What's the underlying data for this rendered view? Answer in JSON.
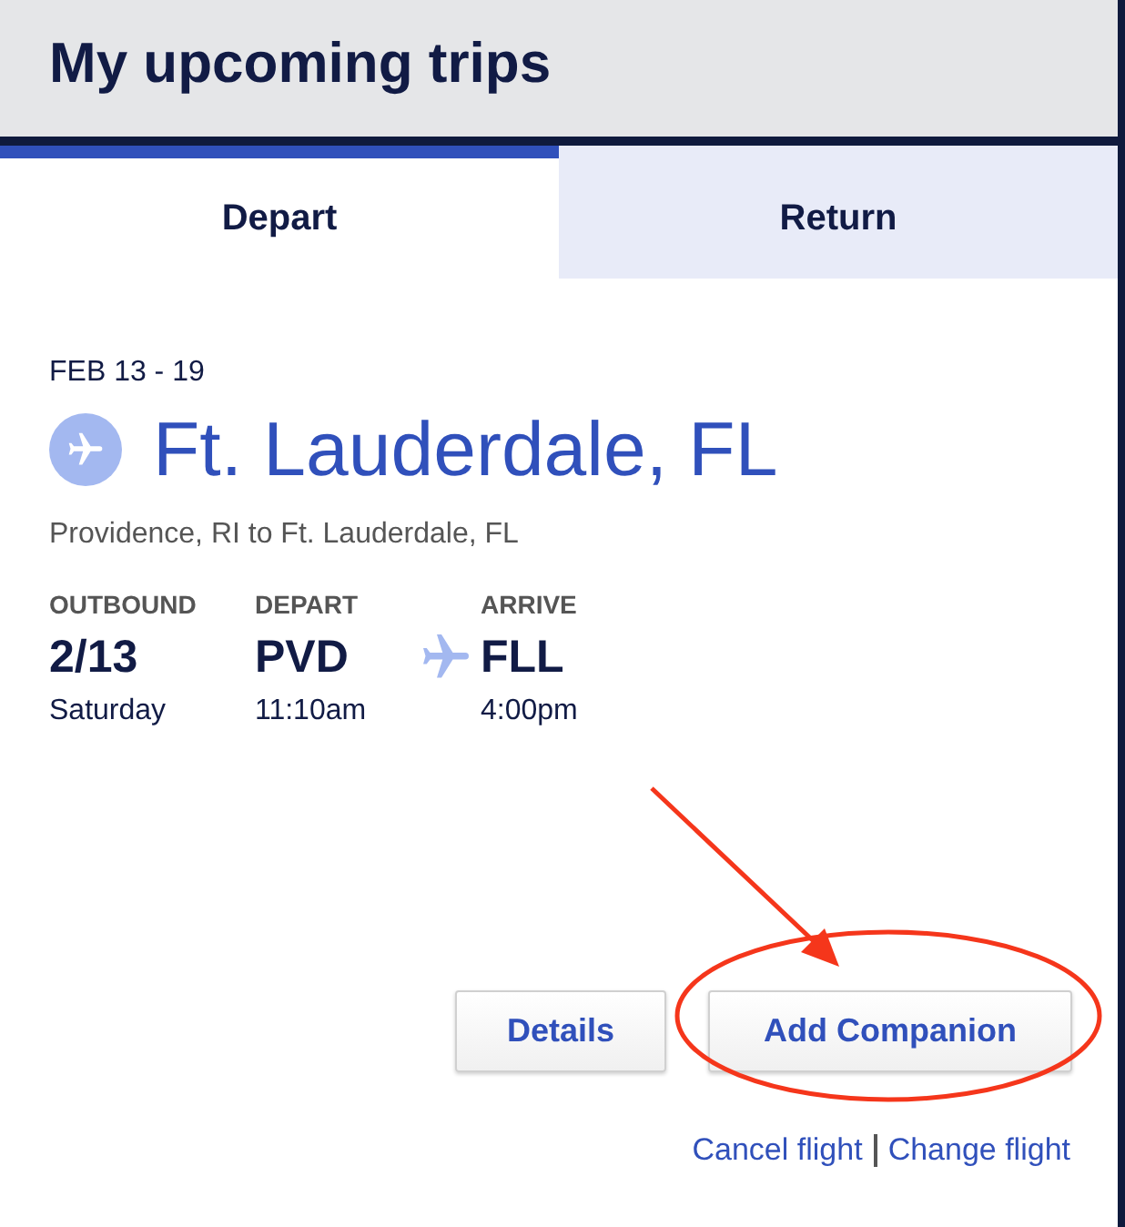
{
  "header": {
    "title": "My upcoming trips"
  },
  "tabs": [
    {
      "label": "Depart",
      "selected": true
    },
    {
      "label": "Return",
      "selected": false
    }
  ],
  "trip": {
    "dates": "FEB 13 - 19",
    "destination": "Ft. Lauderdale, FL",
    "route": "Providence, RI to Ft. Lauderdale, FL",
    "columns": [
      {
        "heading": "OUTBOUND",
        "value": "2/13",
        "detail": "Saturday"
      },
      {
        "heading": "DEPART",
        "value": "PVD",
        "detail": "11:10am"
      },
      {
        "heading": "ARRIVE",
        "value": "FLL",
        "detail": "4:00pm"
      }
    ]
  },
  "buttons": [
    {
      "label": "Details",
      "highlighted": false
    },
    {
      "label": "Add Companion",
      "highlighted": true
    }
  ],
  "links": [
    "Cancel flight",
    "Change flight"
  ]
}
